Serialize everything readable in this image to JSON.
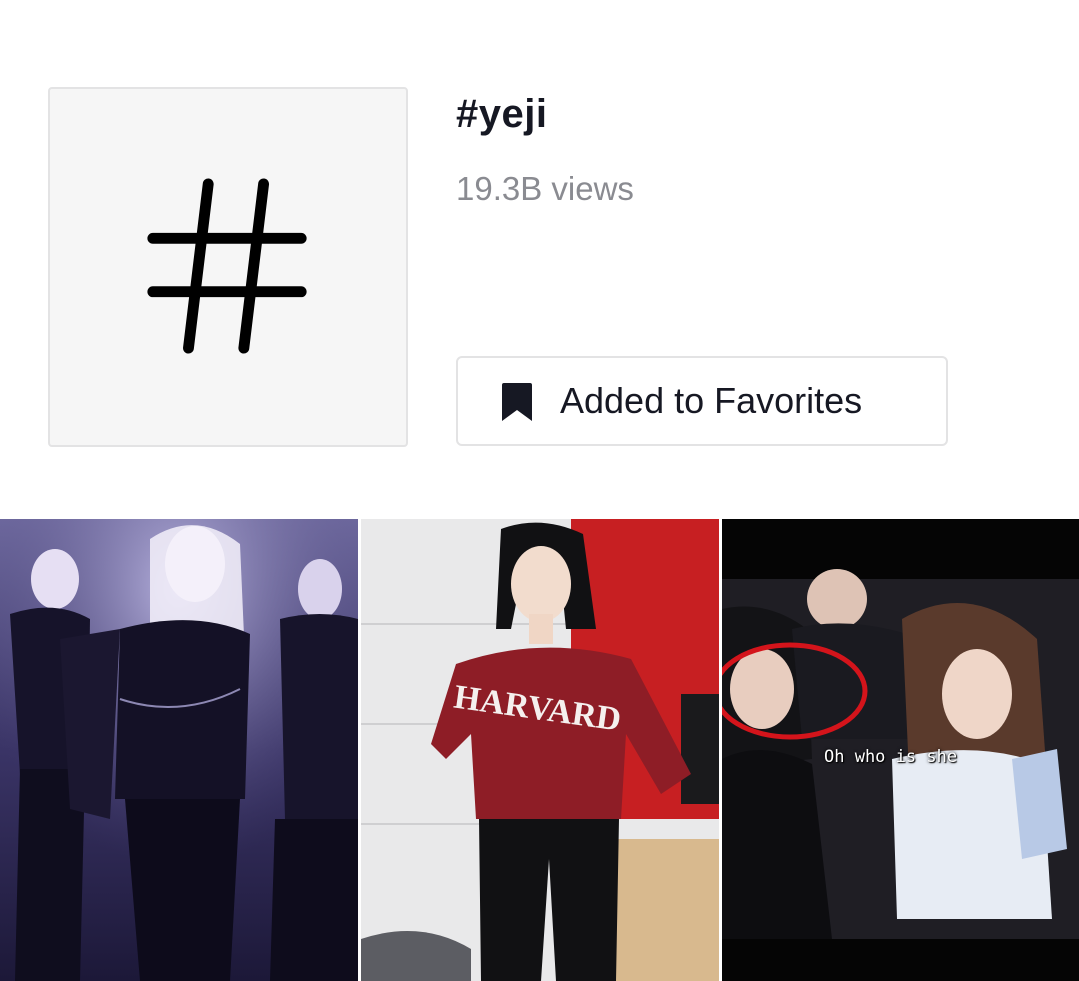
{
  "hashtag": {
    "icon": "hashtag-icon",
    "title": "#yeji",
    "views": "19.3B views"
  },
  "favorite_button": {
    "icon": "bookmark-filled-icon",
    "label": "Added to Favorites"
  },
  "videos": [
    {
      "id": "video-1",
      "caption": ""
    },
    {
      "id": "video-2",
      "caption": ""
    },
    {
      "id": "video-3",
      "caption": "Oh who is she"
    }
  ],
  "colors": {
    "text_primary": "#161823",
    "text_secondary": "#8a8b91",
    "border": "#e3e3e4",
    "tile_bg": "#f6f6f6",
    "annotation_red": "#d4141b"
  }
}
